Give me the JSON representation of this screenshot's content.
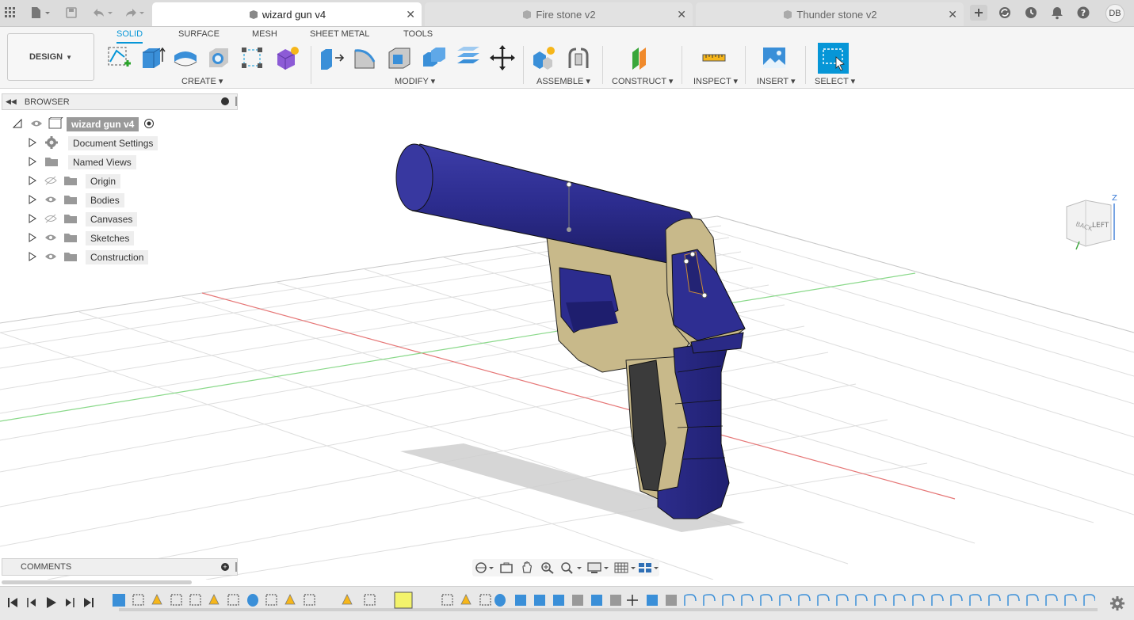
{
  "tabs": [
    {
      "label": "wizard gun v4",
      "active": true
    },
    {
      "label": "Fire stone v2",
      "active": false
    },
    {
      "label": "Thunder stone v2",
      "active": false
    }
  ],
  "user": {
    "initials": "DB"
  },
  "ribbon": {
    "workspace": "DESIGN",
    "tabs": [
      "SOLID",
      "SURFACE",
      "MESH",
      "SHEET METAL",
      "TOOLS"
    ],
    "groups": [
      "CREATE",
      "MODIFY",
      "ASSEMBLE",
      "CONSTRUCT",
      "INSPECT",
      "INSERT",
      "SELECT"
    ]
  },
  "browser": {
    "title": "BROWSER",
    "root": "wizard gun v4",
    "items": [
      {
        "label": "Document Settings",
        "icon": "gear-icon"
      },
      {
        "label": "Named Views",
        "icon": "folder-icon"
      },
      {
        "label": "Origin",
        "icon": "folder-icon",
        "visible": false
      },
      {
        "label": "Bodies",
        "icon": "folder-icon",
        "visible": true
      },
      {
        "label": "Canvases",
        "icon": "folder-icon",
        "visible": false
      },
      {
        "label": "Sketches",
        "icon": "folder-icon",
        "visible": true
      },
      {
        "label": "Construction",
        "icon": "folder-icon",
        "visible": true
      }
    ]
  },
  "comments": {
    "title": "COMMENTS"
  },
  "viewcube": {
    "faces": [
      "BACK",
      "LEFT"
    ],
    "axis_z": "Z"
  },
  "colors": {
    "accent": "#0696d7",
    "body_blue": "#2f2f8f",
    "body_tan": "#c8b98a"
  }
}
